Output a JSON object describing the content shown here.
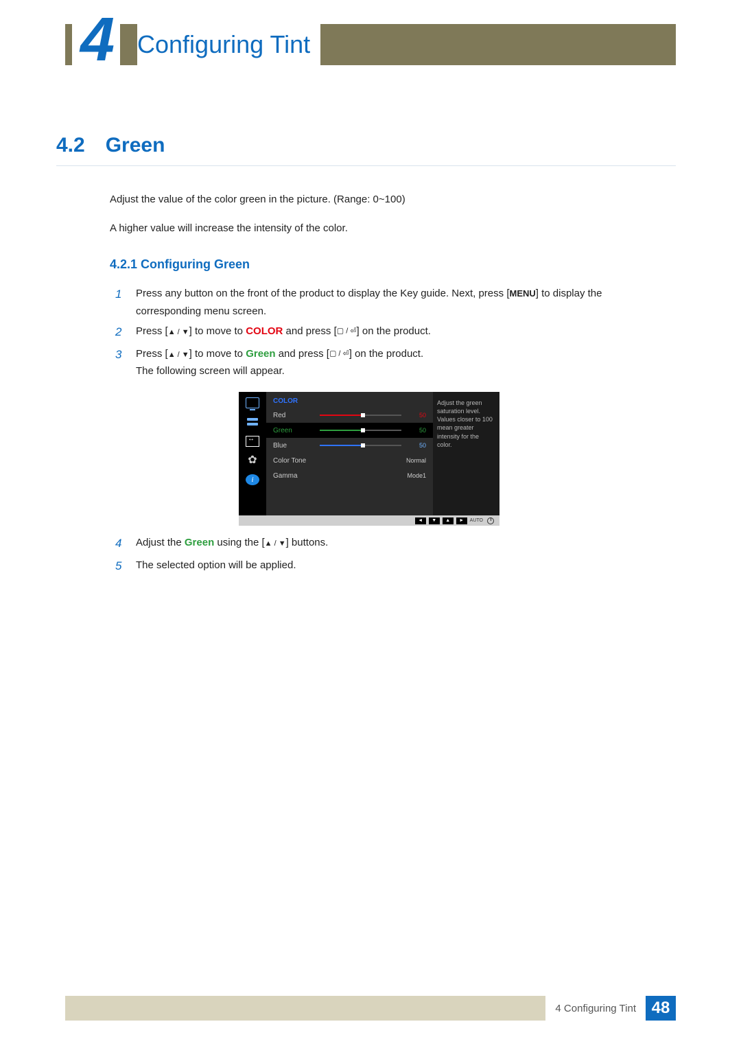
{
  "chapter": {
    "number": "4",
    "title": "Configuring Tint"
  },
  "section": {
    "number": "4.2",
    "title": "Green"
  },
  "intro": {
    "p1": "Adjust the value of the color green in the picture. (Range: 0~100)",
    "p2": "A higher value will increase the intensity of the color."
  },
  "subsection": {
    "number": "4.2.1",
    "title": "Configuring Green",
    "full": "4.2.1   Configuring Green"
  },
  "steps": [
    {
      "n": "1",
      "pre": "Press any button on the front of the product to display the Key guide. Next, press [",
      "kw": "MENU",
      "post": "] to display the corresponding menu screen."
    },
    {
      "n": "2",
      "pre": "Press [",
      "arrows": "▲ / ▼",
      "mid1": "] to move to ",
      "hl": "COLOR",
      "hl_color": "red",
      "mid2": " and press [",
      "sym": "▢ / ⏎",
      "post": "] on the product."
    },
    {
      "n": "3",
      "pre": "Press [",
      "arrows": "▲ / ▼",
      "mid1": "] to move to ",
      "hl": "Green",
      "hl_color": "green",
      "mid2": " and press [",
      "sym": "▢ / ⏎",
      "post": "] on the product.",
      "extra": "The following screen will appear."
    },
    {
      "n": "4",
      "pre": "Adjust the ",
      "hl": "Green",
      "hl_color": "green",
      "mid": " using the [",
      "arrows": "▲ / ▼",
      "post": "] buttons."
    },
    {
      "n": "5",
      "text": "The selected option will be applied."
    }
  ],
  "osd": {
    "title": "COLOR",
    "rows": [
      {
        "label": "Red",
        "type": "slider",
        "value": 50,
        "color": "red",
        "val_display": "50",
        "selected": false
      },
      {
        "label": "Green",
        "type": "slider",
        "value": 50,
        "color": "green",
        "val_display": "50",
        "selected": true
      },
      {
        "label": "Blue",
        "type": "slider",
        "value": 50,
        "color": "blue",
        "val_display": "50",
        "selected": false
      },
      {
        "label": "Color Tone",
        "type": "text",
        "text_value": "Normal"
      },
      {
        "label": "Gamma",
        "type": "text",
        "text_value": "Mode1"
      }
    ],
    "info": "Adjust the green saturation level. Values closer to 100 mean greater intensity for the color.",
    "footer": {
      "auto": "AUTO"
    }
  },
  "footer": {
    "label": "4 Configuring Tint",
    "page": "48"
  }
}
